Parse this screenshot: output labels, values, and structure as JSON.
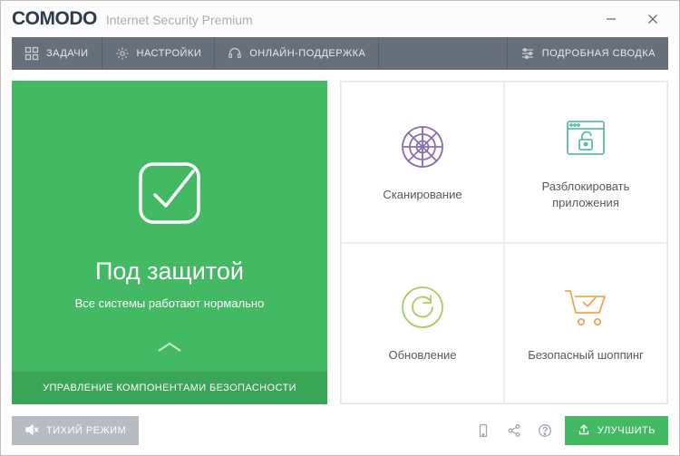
{
  "titlebar": {
    "brand": "COMODO",
    "subtitle": "Internet Security Premium"
  },
  "toolbar": {
    "tasks": "ЗАДАЧИ",
    "settings": "НАСТРОЙКИ",
    "support": "ОНЛАЙН-ПОДДЕРЖКА",
    "detailed": "ПОДРОБНАЯ СВОДКА"
  },
  "status": {
    "title": "Под защитой",
    "subtitle": "Все системы работают нормально",
    "footer": "УПРАВЛЕНИЕ КОМПОНЕНТАМИ БЕЗОПАСНОСТИ"
  },
  "tiles": {
    "scan": "Сканирование",
    "unblock": "Разблокировать\nприложения",
    "update": "Обновление",
    "shopping": "Безопасный шоппинг"
  },
  "footer": {
    "quiet": "ТИХИЙ РЕЖИМ",
    "improve": "УЛУЧШИТЬ"
  },
  "colors": {
    "accent_green": "#43b963",
    "toolbar_gray": "#676f7b",
    "tile_purple": "#8a6fb0",
    "tile_teal": "#5fbca8",
    "tile_lime": "#a8ce5a",
    "tile_orange": "#f0a55a"
  }
}
